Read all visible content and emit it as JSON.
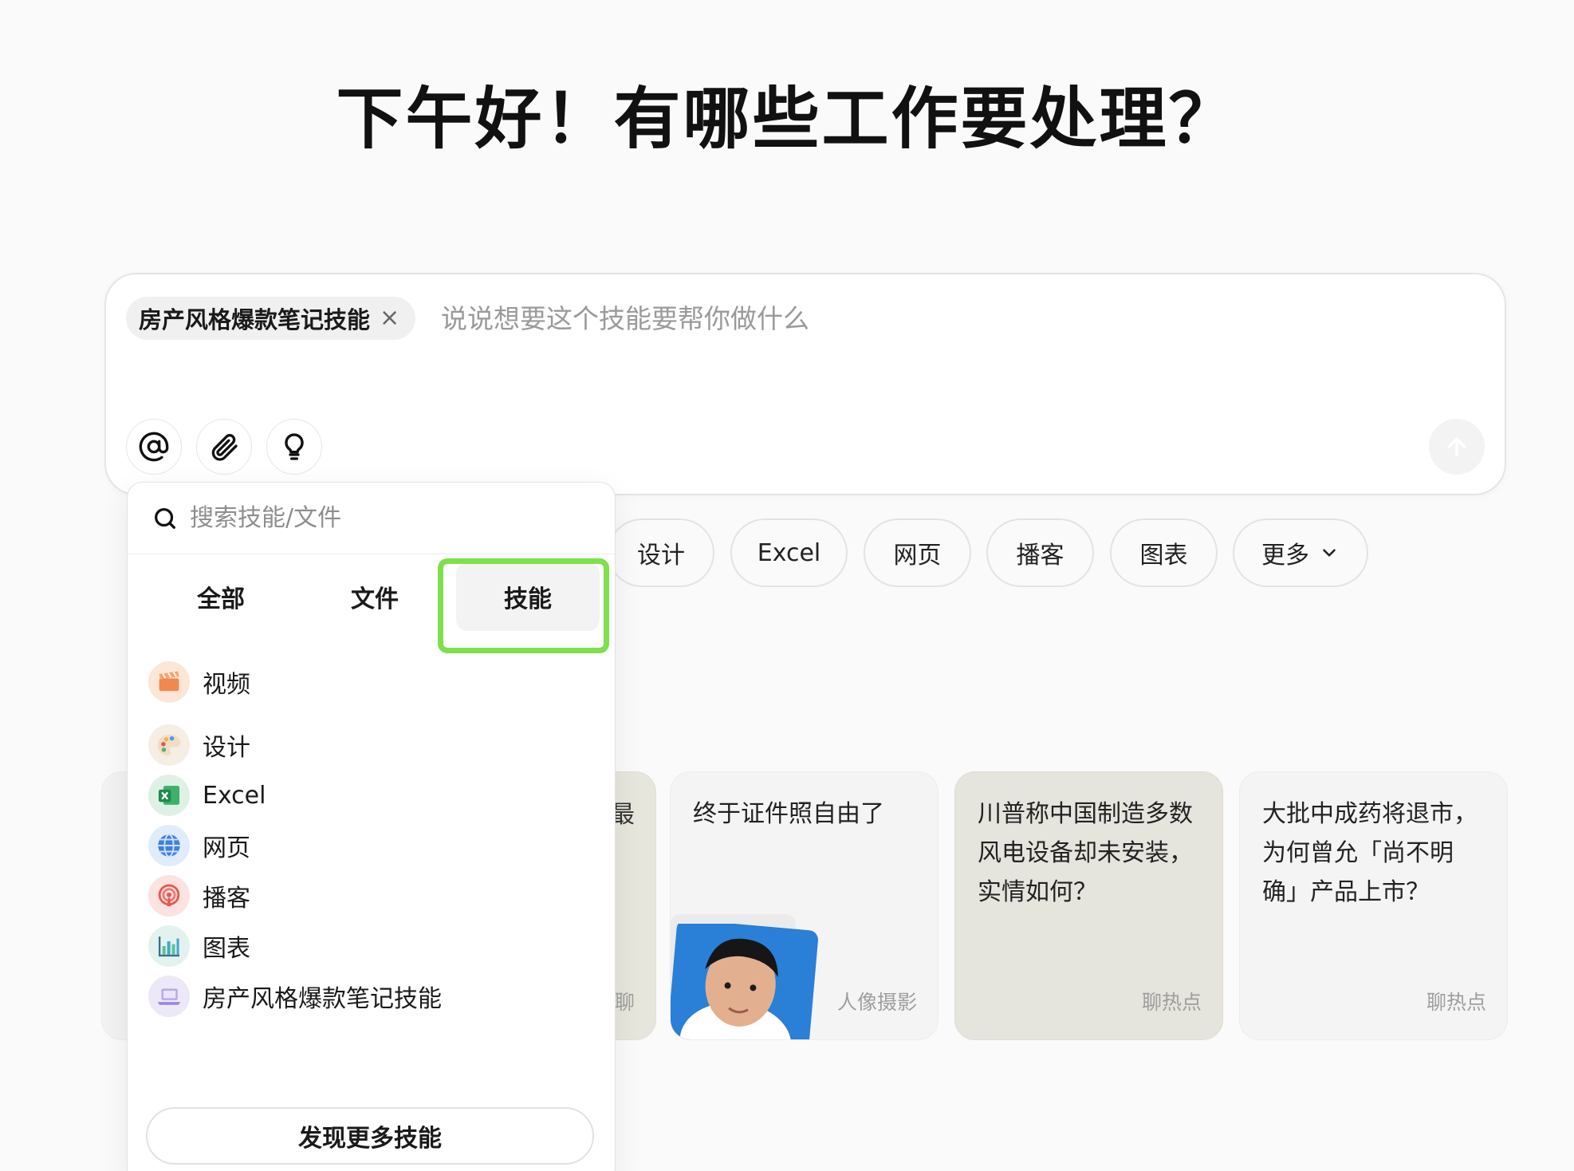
{
  "greeting": "下午好！有哪些工作要处理？",
  "composer": {
    "chip_label": "房产风格爆款笔记技能",
    "chip_close": "×",
    "placeholder": "说说想要这个技能要帮你做什么",
    "tools": [
      "at-icon",
      "paperclip-icon",
      "lightbulb-icon"
    ],
    "send_icon": "arrow-up-icon"
  },
  "categories": [
    "设计",
    "Excel",
    "网页",
    "播客",
    "图表",
    "更多"
  ],
  "cards": [
    {
      "title": "终于证件照自由了",
      "tag": "人像摄影"
    },
    {
      "title": "川普称中国制造多数风电设备却未安装，实情如何？",
      "tag": "聊热点"
    },
    {
      "title": "大批中成药将退市，为何曾允「尚不明确」产品上市？",
      "tag": "聊热点"
    }
  ],
  "partial_card_fragments": {
    "left_card_char": "最",
    "left_card_tag": "聊"
  },
  "popup": {
    "search_placeholder": "搜索技能/文件",
    "tabs": [
      "全部",
      "文件",
      "技能"
    ],
    "active_tab": "技能",
    "items": [
      {
        "label": "视频",
        "icon": "clapperboard-icon"
      },
      {
        "label": "设计",
        "icon": "palette-icon"
      },
      {
        "label": "Excel",
        "icon": "excel-icon"
      },
      {
        "label": "网页",
        "icon": "globe-icon"
      },
      {
        "label": "播客",
        "icon": "podcast-icon"
      },
      {
        "label": "图表",
        "icon": "bar-chart-icon"
      },
      {
        "label": "房产风格爆款笔记技能",
        "icon": "laptop-icon"
      }
    ],
    "more_button": "发现更多技能"
  },
  "colors": {
    "background": "#fafafa",
    "highlight": "#7ee04d",
    "excel_green": "#1f8a4c",
    "video_orange": "#f0884f",
    "podcast_red": "#e8584f",
    "globe_blue": "#3f7fe0"
  }
}
